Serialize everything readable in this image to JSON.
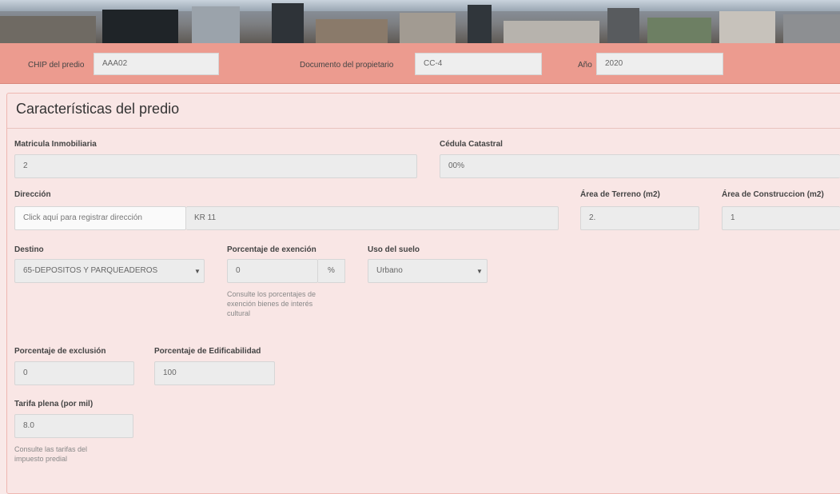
{
  "header": {
    "chip_label": "CHIP del predio",
    "chip_value": "AAA02",
    "documento_label": "Documento del propietario",
    "documento_value": "CC-4",
    "anio_label": "Año",
    "anio_value": "2020"
  },
  "section": {
    "title": "Características del predio"
  },
  "form": {
    "matricula_label": "Matricula Inmobiliaria",
    "matricula_value": "2",
    "cedula_label": "Cédula Catastral",
    "cedula_value": "00%",
    "direccion_label": "Dirección",
    "direccion_button": "Click aquí para registrar dirección",
    "direccion_value": "KR 11",
    "area_terreno_label": "Área de Terreno (m2)",
    "area_terreno_value": "2.",
    "area_construccion_label": "Área de Construccion (m2)",
    "area_construccion_value": "1",
    "destino_label": "Destino",
    "destino_value": "65-DEPOSITOS Y PARQUEADEROS",
    "exencion_label": "Porcentaje de exención",
    "exencion_value": "0",
    "exencion_addon": "%",
    "exencion_help": [
      "Consulte los porcentajes de",
      "exención bienes de interés",
      "cultural"
    ],
    "uso_label": "Uso del suelo",
    "uso_value": "Urbano",
    "exclusion_label": "Porcentaje de exclusión",
    "exclusion_value": "0",
    "edificabilidad_label": "Porcentaje de Edificabilidad",
    "edificabilidad_value": "100",
    "tarifa_label": "Tarifa plena (por mil)",
    "tarifa_value": "8.0",
    "tarifa_help": [
      "Consulte las tarifas del",
      "impuesto predial"
    ]
  },
  "icons": {
    "dropdown": "caret-down-icon"
  }
}
